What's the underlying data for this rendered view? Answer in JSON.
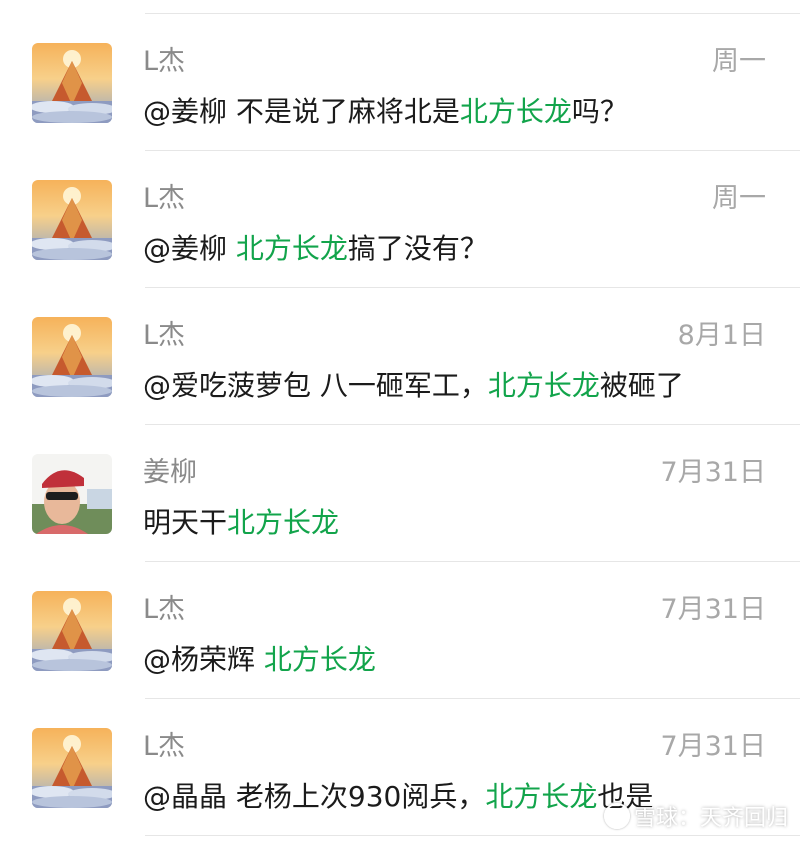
{
  "messages": [
    {
      "sender": "L杰",
      "time": "周一",
      "prefix": "@姜柳 不是说了麻将北是",
      "highlight": "北方长龙",
      "suffix": "吗？",
      "avatar": "mountain-avatar"
    },
    {
      "sender": "L杰",
      "time": "周一",
      "prefix": "@姜柳 ",
      "highlight": "北方长龙",
      "suffix": "搞了没有？",
      "avatar": "mountain-avatar"
    },
    {
      "sender": "L杰",
      "time": "8月1日",
      "prefix": "@爱吃菠萝包 八一砸军工，",
      "highlight": "北方长龙",
      "suffix": "被砸了",
      "avatar": "mountain-avatar"
    },
    {
      "sender": "姜柳",
      "time": "7月31日",
      "prefix": "明天干",
      "highlight": "北方长龙",
      "suffix": "",
      "avatar": "person-avatar"
    },
    {
      "sender": "L杰",
      "time": "7月31日",
      "prefix": "@杨荣辉 ",
      "highlight": "北方长龙",
      "suffix": "",
      "avatar": "mountain-avatar"
    },
    {
      "sender": "L杰",
      "time": "7月31日",
      "prefix": "@晶晶 老杨上次930阅兵，",
      "highlight": "北方长龙",
      "suffix": "也是",
      "avatar": "mountain-avatar"
    }
  ],
  "watermark": "雪球：天齐回归",
  "colors": {
    "highlight": "#12a44b",
    "name": "#8a8a8a",
    "time": "#a8a8a8",
    "text": "#1b1b1b",
    "divider": "#e6e6e6"
  }
}
